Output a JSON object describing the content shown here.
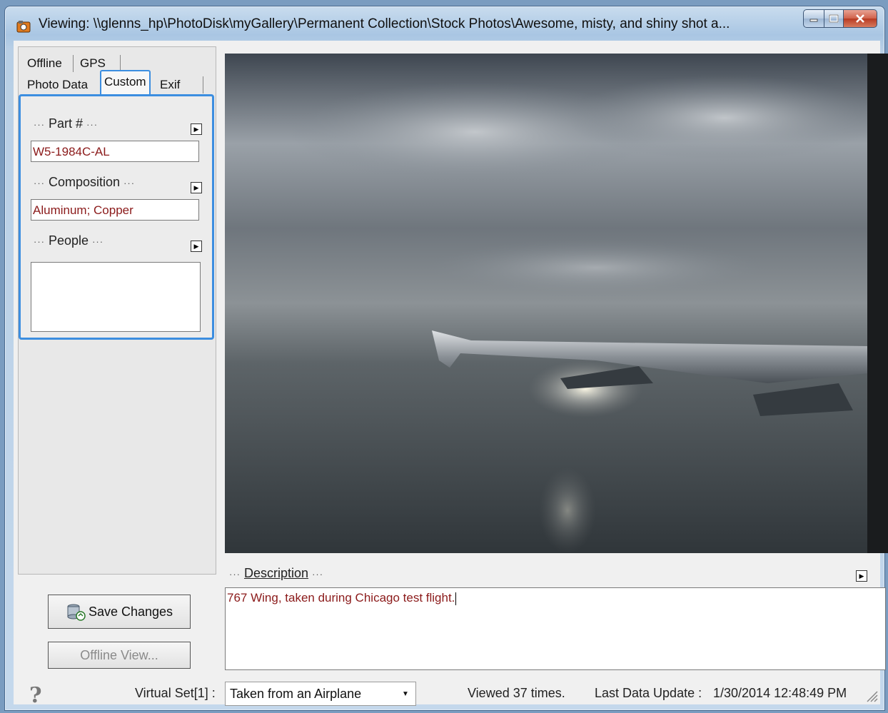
{
  "window": {
    "title": "Viewing: \\\\glenns_hp\\PhotoDisk\\myGallery\\Permanent Collection\\Stock Photos\\Awesome, misty, and shiny shot a...",
    "app_icon": "camera-app-icon",
    "controls": {
      "minimize": "minimize-icon",
      "maximize": "maximize-icon",
      "close": "close-icon"
    }
  },
  "tabs": {
    "row1": [
      "Offline",
      "GPS"
    ],
    "row2": [
      "Photo Data",
      "Custom",
      "Exif"
    ],
    "active": "Custom"
  },
  "custom_fields": {
    "part_label": "Part #",
    "part_value": "W5-1984C-AL",
    "composition_label": "Composition",
    "composition_value": "Aluminum; Copper",
    "people_label": "People",
    "people_value": "",
    "dots": "···"
  },
  "description": {
    "label": "Description",
    "value": "767 Wing, taken during Chicago test flight."
  },
  "buttons": {
    "save_label": "Save Changes",
    "offline_view_label": "Offline View..."
  },
  "status": {
    "virtual_set_label": "Virtual Set[1] :",
    "virtual_set_value": "Taken from an Airplane",
    "viewed": "Viewed 37 times.",
    "last_update_label": "Last Data Update :",
    "last_update_value": "1/30/2014 12:48:49 PM"
  },
  "colors": {
    "accent": "#3c8ee0",
    "value_text": "#8b1a1a"
  }
}
